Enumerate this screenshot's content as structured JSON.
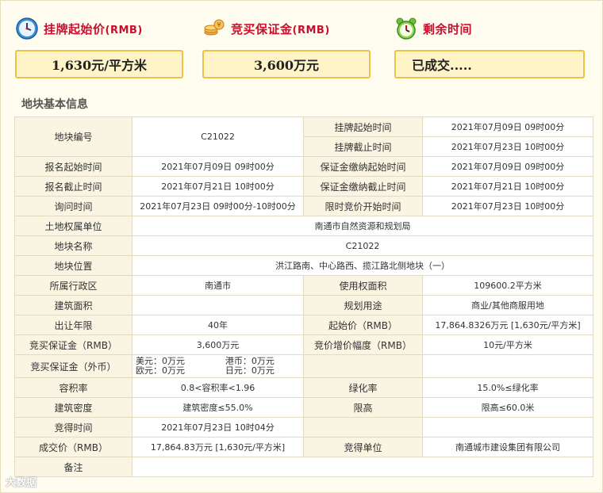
{
  "summary": {
    "start_price": {
      "title": "挂牌起始价",
      "unit_tag": "(RMB)",
      "value": "1,630元/平方米",
      "icon": "clock-icon"
    },
    "deposit": {
      "title": "竞买保证金",
      "unit_tag": "(RMB)",
      "value": "3,600万元",
      "icon": "coins-icon"
    },
    "remaining": {
      "title": "剩余时间",
      "value": "已成交.....",
      "icon": "alarm-clock-icon"
    }
  },
  "section_title": "地块基本信息",
  "table": {
    "r1": {
      "l1": "地块编号",
      "v1": "C21022",
      "l2a": "挂牌起始时间",
      "v2a": "2021年07月09日 09时00分",
      "l2b": "挂牌截止时间",
      "v2b": "2021年07月23日 10时00分"
    },
    "r2": {
      "l1": "报名起始时间",
      "v1": "2021年07月09日 09时00分",
      "l2": "保证金缴纳起始时间",
      "v2": "2021年07月09日 09时00分"
    },
    "r3": {
      "l1": "报名截止时间",
      "v1": "2021年07月21日 10时00分",
      "l2": "保证金缴纳截止时间",
      "v2": "2021年07月21日 10时00分"
    },
    "r4": {
      "l1": "询问时间",
      "v1": "2021年07月23日 09时00分-10时00分",
      "l2": "限时竞价开始时间",
      "v2": "2021年07月23日 10时00分"
    },
    "r5": {
      "l1": "土地权属单位",
      "v1": "南通市自然资源和规划局"
    },
    "r6": {
      "l1": "地块名称",
      "v1": "C21022"
    },
    "r7": {
      "l1": "地块位置",
      "v1": "洪江路南、中心路西、揽江路北侧地块（一）"
    },
    "r8": {
      "l1": "所属行政区",
      "v1": "南通市",
      "l2": "使用权面积",
      "v2": "109600.2平方米"
    },
    "r9": {
      "l1": "建筑面积",
      "v1": "",
      "l2": "规划用途",
      "v2": "商业/其他商服用地"
    },
    "r10": {
      "l1": "出让年限",
      "v1": "40年",
      "l2": "起始价（RMB）",
      "v2": "17,864.8326万元 [1,630元/平方米]"
    },
    "r11": {
      "l1": "竞买保证金（RMB）",
      "v1": "3,600万元",
      "l2": "竞价增价幅度（RMB）",
      "v2": "10元/平方米"
    },
    "r12": {
      "l1": "竞买保证金（外币）",
      "usd": "美元：0万元",
      "hkd": "港币：0万元",
      "eur": "欧元：0万元",
      "jpy": "日元：0万元",
      "l2": "",
      "v2": ""
    },
    "r13": {
      "l1": "容积率",
      "v1": "0.8<容积率<1.96",
      "l2": "绿化率",
      "v2": "15.0%≤绿化率"
    },
    "r14": {
      "l1": "建筑密度",
      "v1": "建筑密度≤55.0%",
      "l2": "限高",
      "v2": "限高≤60.0米"
    },
    "r15": {
      "l1": "竞得时间",
      "v1": "2021年07月23日 10时04分",
      "l2": "",
      "v2": ""
    },
    "r16": {
      "l1": "成交价（RMB）",
      "v1": "17,864.83万元 [1,630元/平方米]",
      "l2": "竞得单位",
      "v2": "南通城市建设集团有限公司"
    },
    "r17": {
      "l1": "备注",
      "v1": ""
    }
  },
  "watermark": {
    "text": "大数据"
  },
  "colors": {
    "accent_red": "#c8102e",
    "box_border": "#f0c040",
    "box_bg": "#fff4c8",
    "label_bg": "#faf4e2"
  }
}
